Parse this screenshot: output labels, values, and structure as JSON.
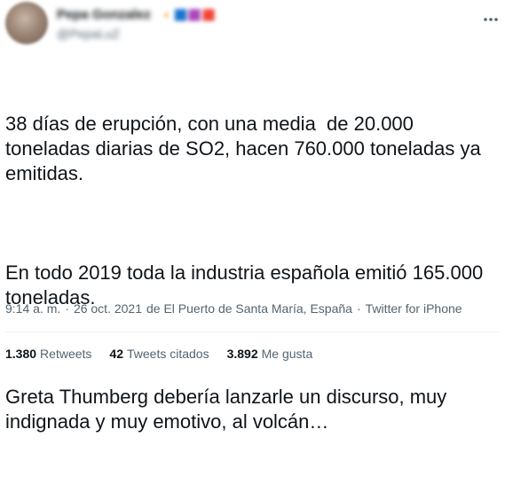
{
  "author": {
    "display_name": "Pepa Gonzalez",
    "name_emojis": "🔸🟦🟪🟥",
    "handle": "@PepaLuZ"
  },
  "tweet": {
    "paragraphs": [
      "38 días de erupción, con una media  de 20.000 toneladas diarias de SO2, hacen 760.000 toneladas ya emitidas.",
      "En todo 2019 toda la industria española emitió 165.000 toneladas.",
      "Greta Thumberg debería lanzarle un discurso, muy indignada y muy emotivo, al volcán…"
    ]
  },
  "meta": {
    "time": "9:14 a. m.",
    "sep1": "·",
    "date": "26 oct. 2021",
    "location": "de El Puerto de Santa María, España",
    "sep2": "·",
    "source": "Twitter for iPhone"
  },
  "stats": {
    "retweets_count": "1.380",
    "retweets_label": "Retweets",
    "quotes_count": "42",
    "quotes_label": "Tweets citados",
    "likes_count": "3.892",
    "likes_label": "Me gusta"
  },
  "icons": {
    "more": "more-horizontal-icon"
  },
  "colors": {
    "text": "#0f1419",
    "secondary": "#536471",
    "divider": "#eff3f4"
  }
}
